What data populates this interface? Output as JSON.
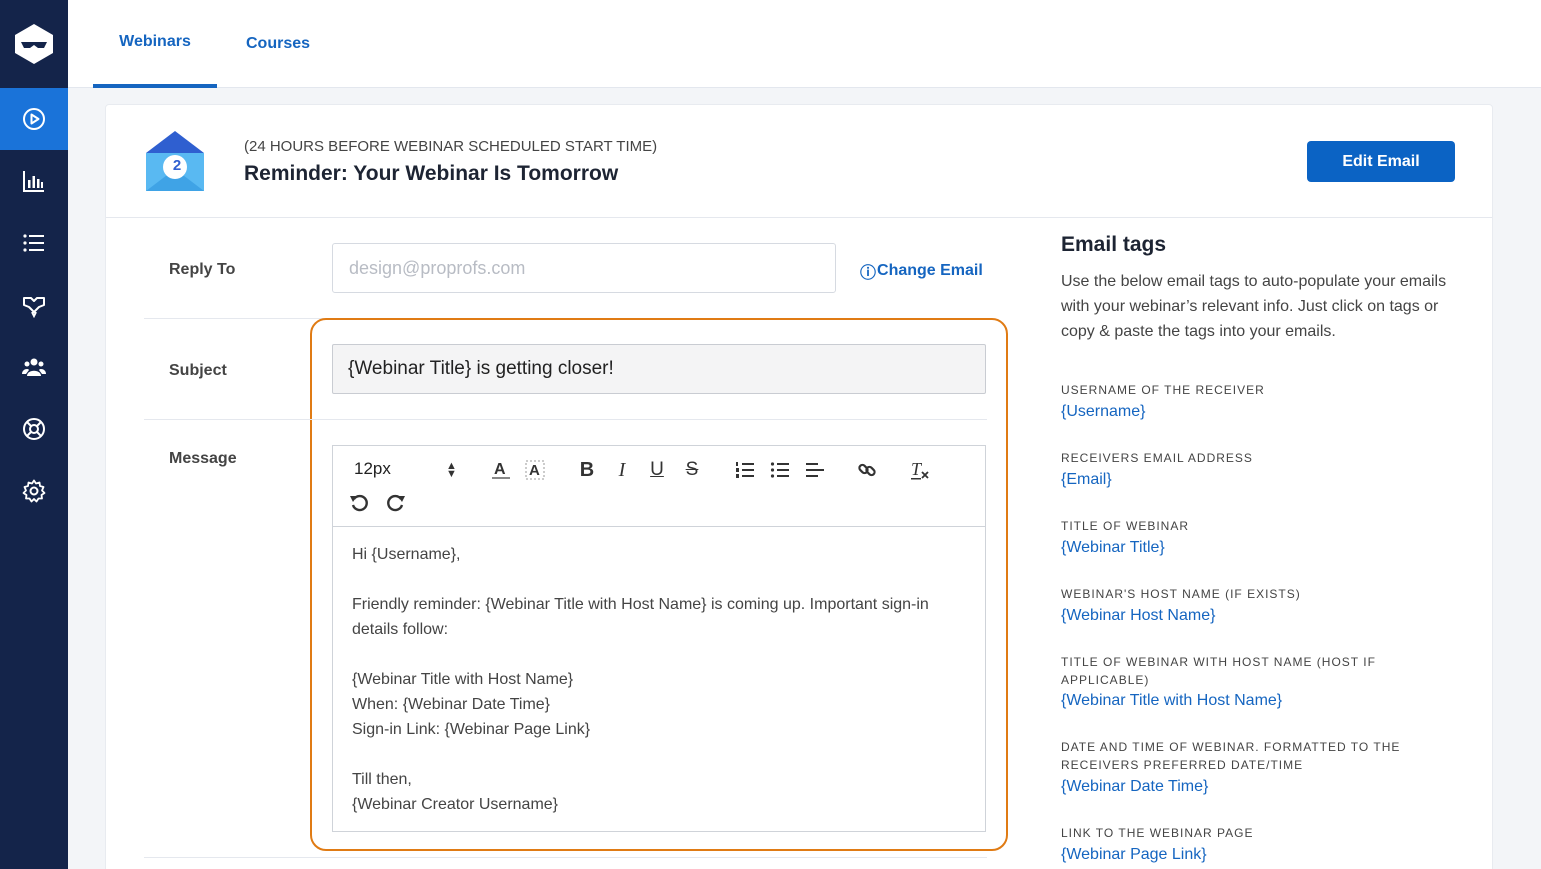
{
  "tabs": [
    "Webinars",
    "Courses"
  ],
  "header": {
    "subtitle": "(24 HOURS BEFORE WEBINAR SCHEDULED START TIME)",
    "title": "Reminder: Your Webinar Is Tomorrow",
    "badge": "2",
    "edit_button": "Edit Email"
  },
  "form": {
    "reply_to_label": "Reply To",
    "reply_to_placeholder": "design@proprofs.com",
    "change_email": "Change Email",
    "subject_label": "Subject",
    "subject_value": "{Webinar Title} is getting closer!",
    "message_label": "Message",
    "font_size": "12px",
    "message_body": "Hi {Username},\n\nFriendly reminder: {Webinar Title with Host Name} is coming up. Important sign-in details follow:\n\n{Webinar Title with Host Name}\nWhen: {Webinar Date Time}\nSign-in Link: {Webinar Page Link}\n\nTill then,\n{Webinar Creator Username}"
  },
  "email_tags": {
    "title": "Email tags",
    "description": "Use the below email tags to auto-populate your emails with your webinar’s relevant info. Just click on tags or copy & paste the tags into your emails.",
    "items": [
      {
        "label": "USERNAME OF THE RECEIVER",
        "tag": "{Username}"
      },
      {
        "label": "RECEIVERS EMAIL ADDRESS",
        "tag": "{Email}"
      },
      {
        "label": "TITLE OF WEBINAR",
        "tag": "{Webinar Title}"
      },
      {
        "label": "WEBINAR'S HOST NAME (IF EXISTS)",
        "tag": "{Webinar Host Name}"
      },
      {
        "label": "TITLE OF WEBINAR WITH HOST NAME (HOST IF APPLICABLE)",
        "tag": "{Webinar Title with Host Name}"
      },
      {
        "label": "DATE AND TIME OF WEBINAR. FORMATTED TO THE RECEIVERS PREFERRED DATE/TIME",
        "tag": "{Webinar Date Time}"
      },
      {
        "label": "LINK TO THE WEBINAR PAGE",
        "tag": "{Webinar Page Link}"
      }
    ]
  },
  "colors": {
    "sidebar": "#14244a",
    "accent": "#1565c0",
    "highlight": "#e07b14"
  },
  "sidebar_icons": [
    "logo-icon",
    "webinar-play-icon",
    "analytics-icon",
    "list-icon",
    "integrations-icon",
    "users-icon",
    "help-icon",
    "settings-icon"
  ]
}
